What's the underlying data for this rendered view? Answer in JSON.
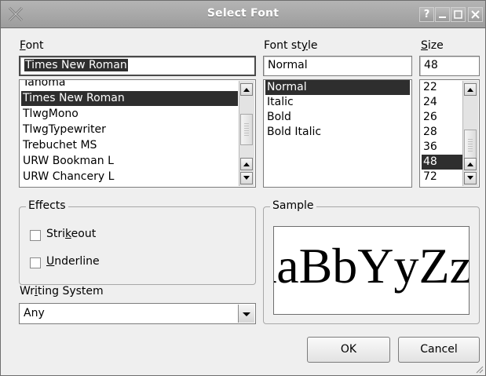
{
  "window": {
    "title": "Select Font",
    "controls": {
      "help": "?",
      "minimize": "_",
      "maximize": "□",
      "close": "✕"
    }
  },
  "font": {
    "label_prefix": "",
    "label_mnemonic": "F",
    "label_rest": "ont",
    "value": "Times New Roman",
    "list": [
      "Tahoma",
      "Times New Roman",
      "TlwgMono",
      "TlwgTypewriter",
      "Trebuchet MS",
      "URW Bookman L",
      "URW Chancery L"
    ],
    "selected": "Times New Roman"
  },
  "style": {
    "label_prefix": "Font st",
    "label_mnemonic": "y",
    "label_rest": "le",
    "value": "Normal",
    "list": [
      "Normal",
      "Italic",
      "Bold",
      "Bold Italic"
    ],
    "selected": "Normal"
  },
  "size": {
    "label_prefix": "",
    "label_mnemonic": "S",
    "label_rest": "ize",
    "value": "48",
    "list": [
      "22",
      "24",
      "26",
      "28",
      "36",
      "48",
      "72"
    ],
    "selected": "48"
  },
  "effects": {
    "title": "Effects",
    "strikeout": {
      "prefix": "Stri",
      "mnemonic": "k",
      "rest": "eout",
      "checked": false
    },
    "underline": {
      "prefix": "",
      "mnemonic": "U",
      "rest": "nderline",
      "checked": false
    }
  },
  "writing_system": {
    "label_prefix": "Wr",
    "label_mnemonic": "i",
    "label_rest": "ting System",
    "value": "Any"
  },
  "sample": {
    "title": "Sample",
    "text": "AaBbYyZz"
  },
  "buttons": {
    "ok": "OK",
    "cancel": "Cancel"
  },
  "colors": {
    "selection": "#2e2e2e",
    "titlebar": "#a9a9a9",
    "dialog_bg": "#efefef"
  }
}
